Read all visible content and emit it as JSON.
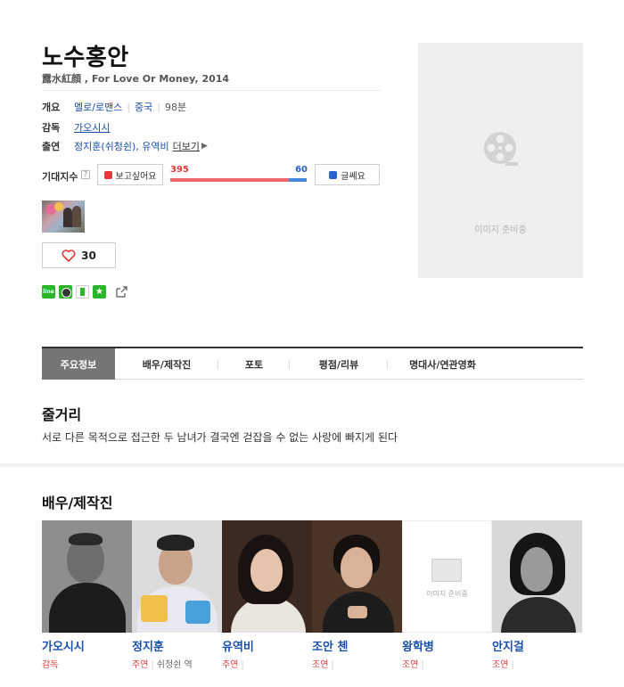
{
  "movie": {
    "title": "노수홍안",
    "original_title": "露水紅顔 , For Love Or Money, 2014"
  },
  "info": {
    "overview_label": "개요",
    "genre": "멜로/로맨스",
    "country": "중국",
    "runtime": "98분",
    "director_label": "감독",
    "director": "가오시시",
    "cast_label": "출연",
    "cast_names": "정지훈(쉬청쉰), 유역비",
    "more_label": "더보기"
  },
  "expectation": {
    "label": "기대지수",
    "help_icon": "?",
    "want_label": "보고싶어요",
    "want_count": "395",
    "dislike_label": "글쎄요",
    "dislike_count": "60",
    "want_ratio": 0.868
  },
  "like": {
    "count": "30"
  },
  "share": {
    "line_label": "line",
    "icons": [
      "line-icon",
      "kakao-icon",
      "cloud-icon",
      "star-icon",
      "external-link-icon"
    ]
  },
  "poster": {
    "placeholder_text": "이미지 준비중"
  },
  "tabs": [
    {
      "label": "주요정보",
      "active": true
    },
    {
      "label": "배우/제작진",
      "active": false
    },
    {
      "label": "포토",
      "active": false
    },
    {
      "label": "평점/리뷰",
      "active": false
    },
    {
      "label": "명대사/연관영화",
      "active": false
    }
  ],
  "plot": {
    "heading": "줄거리",
    "text": "서로 다른 목적으로 접근한 두 남녀가 결국엔 걷잡을 수 없는 사랑에 빠지게 된다"
  },
  "cast_section": {
    "heading": "배우/제작진",
    "placeholder_text": "이미지 준비중",
    "members": [
      {
        "name": "가오시시",
        "role": "감독",
        "character": ""
      },
      {
        "name": "정지훈",
        "role": "주연",
        "character": "쉬청쉰 역"
      },
      {
        "name": "유역비",
        "role": "주연",
        "character": ""
      },
      {
        "name": "조안 첸",
        "role": "조연",
        "character": ""
      },
      {
        "name": "왕학병",
        "role": "조연",
        "character": ""
      },
      {
        "name": "안지걸",
        "role": "조연",
        "character": ""
      }
    ]
  },
  "colors": {
    "link_blue": "#1a4fa8",
    "accent_red": "#e03b3b",
    "bar_red": "#f0666c",
    "bar_blue": "#4a88e0",
    "tab_active": "#757575"
  }
}
